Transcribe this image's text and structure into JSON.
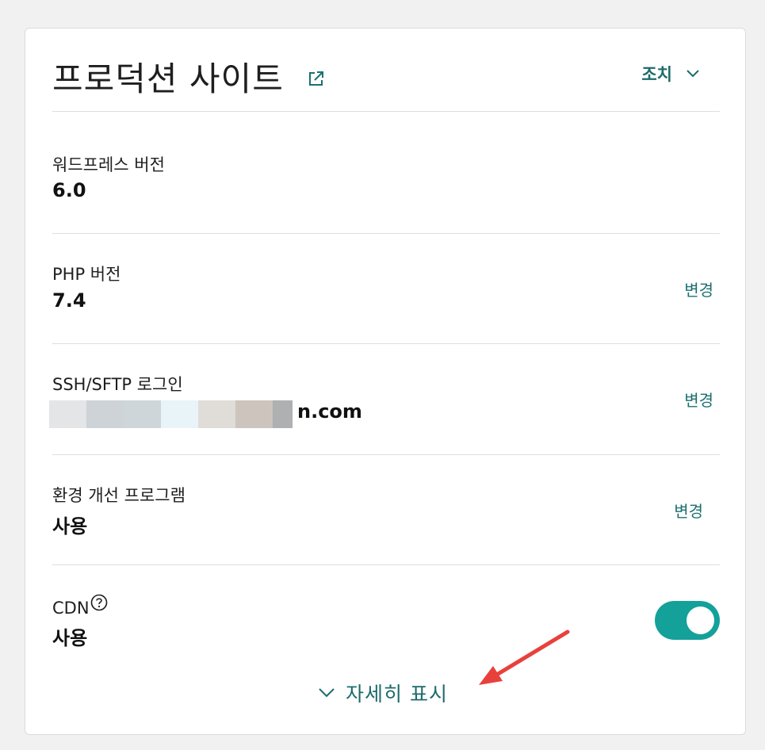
{
  "header": {
    "title": "프로덕션 사이트",
    "external_icon": "external-link-icon",
    "actions_label": "조치",
    "actions_icon": "chevron-down-icon"
  },
  "rows": [
    {
      "label": "워드프레스 버전",
      "value": "6.0"
    },
    {
      "label": "PHP 버전",
      "value": "7.4",
      "action": "변경"
    },
    {
      "label": "SSH/SFTP 로그인",
      "value": "n.com",
      "action": "변경"
    },
    {
      "label": "환경 개선 프로그램",
      "value": "사용",
      "action": "변경"
    },
    {
      "label": "CDN",
      "value": "사용",
      "help_icon": "help-circle-icon",
      "toggle_state": "on"
    }
  ],
  "show_more": {
    "label": "자세히 표시",
    "icon": "chevron-down-icon"
  },
  "colors": {
    "accent": "#1c6b6b",
    "toggle_on": "#13a19a",
    "annotation_arrow": "#e8413c"
  }
}
